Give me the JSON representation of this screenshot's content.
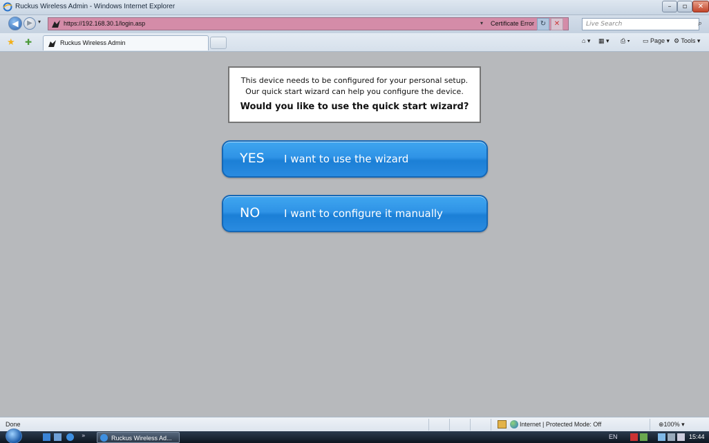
{
  "window": {
    "title": "Ruckus Wireless Admin - Windows Internet Explorer"
  },
  "address_bar": {
    "url": "https://192.168.30.1/login.asp",
    "certificate_label": "Certificate Error",
    "search_placeholder": "Live Search"
  },
  "tabs": [
    {
      "label": "Ruckus Wireless Admin",
      "active": true
    }
  ],
  "command_bar": {
    "page_label": "Page",
    "tools_label": "Tools"
  },
  "content": {
    "message_line1": "This device needs to be configured for your personal setup.",
    "message_line2": "Our quick start wizard can help you configure the device.",
    "question": "Would you like to use the quick start wizard?",
    "yes_button": {
      "key": "YES",
      "desc": "I want to use the wizard"
    },
    "no_button": {
      "key": "NO",
      "desc": "I want to configure it manually"
    },
    "button_color": "#2f93e6"
  },
  "status_bar": {
    "status_text": "Done",
    "zone_text": "Internet | Protected Mode: Off",
    "zoom_text": "100%"
  },
  "taskbar": {
    "task_label": "Ruckus Wireless Ad...",
    "lang": "EN",
    "clock": "15:44"
  }
}
